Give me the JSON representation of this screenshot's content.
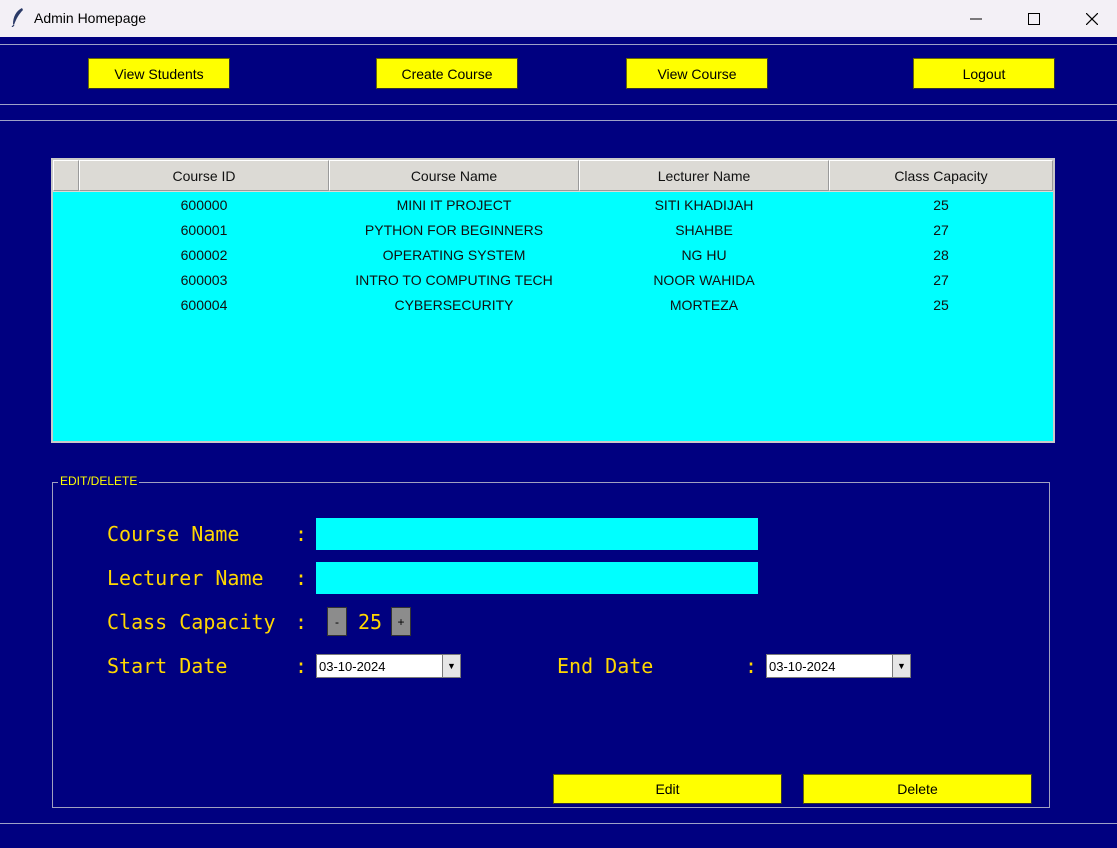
{
  "window": {
    "title": "Admin Homepage",
    "app_icon": "feather-icon",
    "controls": [
      "minimize-icon",
      "maximize-icon",
      "close-icon"
    ]
  },
  "nav": {
    "view_students": "View Students",
    "create_course": "Create Course",
    "view_course": "View Course",
    "logout": "Logout"
  },
  "table": {
    "columns": [
      "Course ID",
      "Course Name",
      "Lecturer Name",
      "Class Capacity"
    ],
    "rows": [
      [
        "600000",
        "MINI IT PROJECT",
        "SITI KHADIJAH",
        "25"
      ],
      [
        "600001",
        "PYTHON FOR BEGINNERS",
        "SHAHBE",
        "27"
      ],
      [
        "600002",
        "OPERATING SYSTEM",
        "NG HU",
        "28"
      ],
      [
        "600003",
        "INTRO TO COMPUTING TECH",
        "NOOR WAHIDA",
        "27"
      ],
      [
        "600004",
        "CYBERSECURITY",
        "MORTEZA",
        "25"
      ]
    ]
  },
  "edit_frame": {
    "label": "EDIT/DELETE",
    "course_name_label": "Course Name",
    "lecturer_name_label": "Lecturer Name",
    "class_capacity_label": "Class Capacity",
    "start_date_label": "Start Date",
    "end_date_label": "End Date",
    "colon": ":",
    "course_name_value": "",
    "lecturer_name_value": "",
    "capacity_minus": "-",
    "capacity_value": "25",
    "capacity_plus": "+",
    "start_date": "03-10-2024",
    "end_date": "03-10-2024",
    "dropdown_arrow": "▼"
  },
  "actions": {
    "edit": "Edit",
    "delete": "Delete"
  },
  "colors": {
    "background": "#000080",
    "button": "#ffff00",
    "table_bg": "#00ffff",
    "label_text": "#ffd700"
  }
}
